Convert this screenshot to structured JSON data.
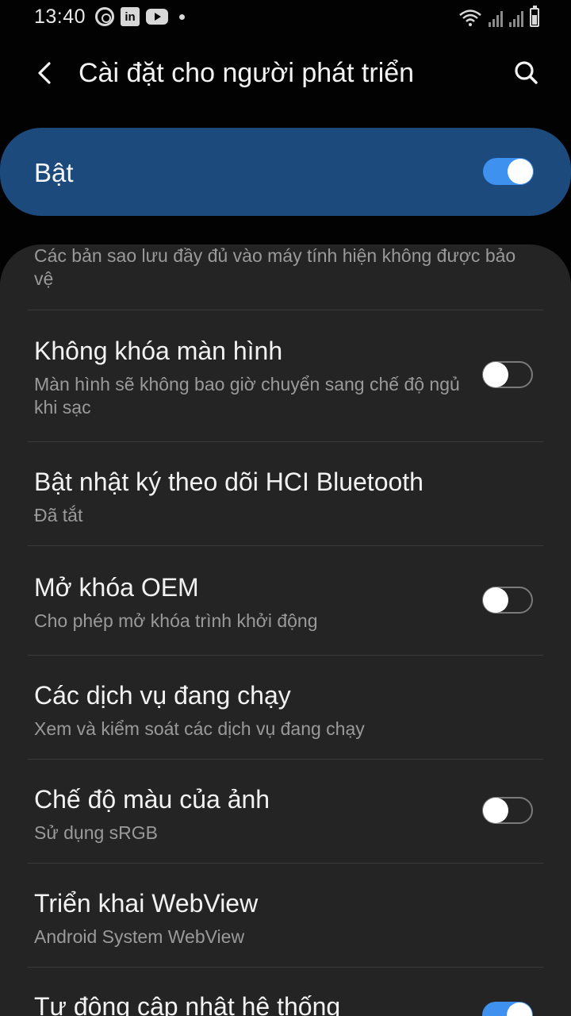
{
  "status_bar": {
    "time": "13:40",
    "notification_icons": [
      "at-sign-icon",
      "linkedin-icon",
      "youtube-icon",
      "dot-icon"
    ],
    "linkedin_glyph": "in",
    "system_icons": [
      "wifi-icon",
      "signal-icon",
      "signal-icon",
      "battery-icon"
    ]
  },
  "app_bar": {
    "back_icon": "chevron-left-icon",
    "title": "Cài đặt cho người phát triển",
    "search_icon": "search-icon"
  },
  "master": {
    "label": "Bật",
    "state": "on",
    "accent_color": "#3e91ef",
    "background_color": "#1c4a7d"
  },
  "settings": {
    "partial_description": "Các bản sao lưu đầy đủ vào máy tính hiện không được bảo vệ",
    "items": [
      {
        "title": "Không khóa màn hình",
        "subtitle": "Màn hình sẽ không bao giờ chuyển sang chế độ ngủ khi sạc",
        "toggle": "off"
      },
      {
        "title": "Bật nhật ký theo dõi HCI Bluetooth",
        "subtitle": "Đã tắt"
      },
      {
        "title": "Mở khóa OEM",
        "subtitle": "Cho phép mở khóa trình khởi động",
        "toggle": "off"
      },
      {
        "title": "Các dịch vụ đang chạy",
        "subtitle": "Xem và kiểm soát các dịch vụ đang chạy"
      },
      {
        "title": "Chế độ màu của ảnh",
        "subtitle": "Sử dụng sRGB",
        "toggle": "off"
      },
      {
        "title": "Triển khai WebView",
        "subtitle": "Android System WebView"
      },
      {
        "title": "Tự động cập nhật hệ thống",
        "toggle": "on"
      }
    ]
  }
}
